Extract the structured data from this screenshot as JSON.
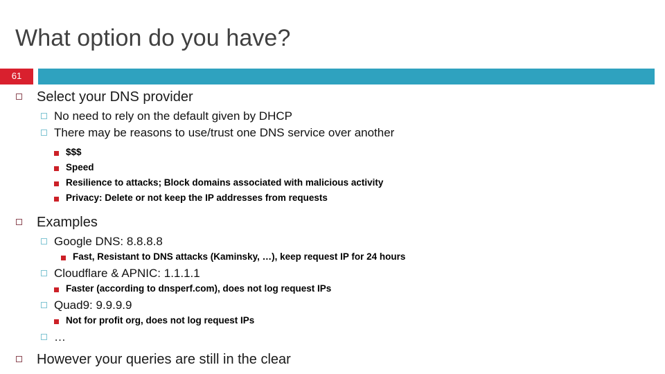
{
  "slide": {
    "title": "What option do you have?",
    "number": "61",
    "accent_teal": "#2fa2bf",
    "accent_red": "#d9202e",
    "bullet_level1_color": "#8c4a55",
    "bullet_level2_color": "#7fc4d2",
    "bullet_level3_color": "#cc2027",
    "title_color": "#404040"
  },
  "content": {
    "section_select": {
      "heading": "Select your DNS provider",
      "points": [
        "No need to rely on the default given by DHCP",
        "There may be reasons to use/trust one DNS service over another"
      ],
      "reasons": [
        "$$$",
        "Speed",
        "Resilience to attacks; Block domains associated with malicious activity",
        "Privacy: Delete or not keep the IP addresses from requests"
      ]
    },
    "section_examples": {
      "heading": "Examples",
      "providers": [
        {
          "name": "Google DNS: 8.8.8.8",
          "note": "Fast, Resistant to DNS attacks (Kaminsky, …), keep request IP for 24 hours"
        },
        {
          "name": "Cloudflare & APNIC: 1.1.1.1",
          "note": "Faster (according to dnsperf.com), does not log request IPs"
        },
        {
          "name": "Quad9: 9.9.9.9",
          "note": "Not for profit org, does not log request IPs"
        }
      ],
      "more": "…"
    },
    "closing": "However your queries are still in the clear"
  }
}
